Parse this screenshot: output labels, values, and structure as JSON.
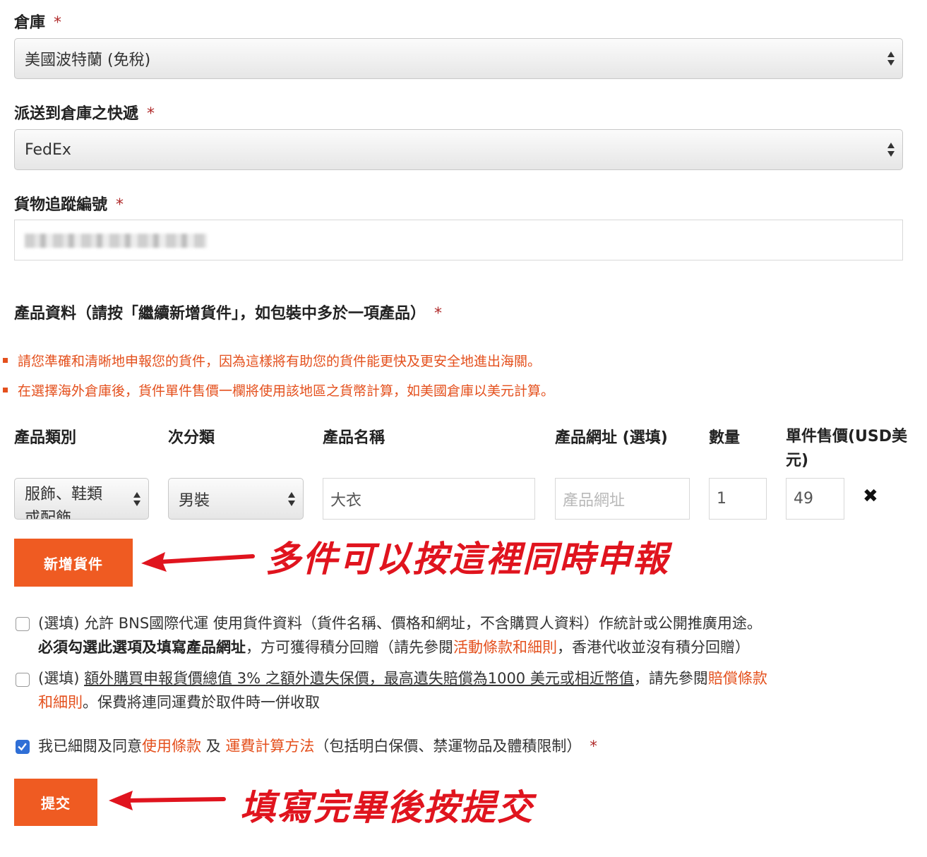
{
  "warehouse": {
    "label": "倉庫",
    "required": "*",
    "selected": "美國波特蘭 (免稅)"
  },
  "courier": {
    "label": "派送到倉庫之快遞",
    "required": "*",
    "selected": "FedEx"
  },
  "tracking": {
    "label": "貨物追蹤編號",
    "required": "*"
  },
  "products": {
    "label": "產品資料（請按「繼續新增貨件」，如包裝中多於一項產品）",
    "required": "*",
    "notices": [
      "請您準確和清晰地申報您的貨件，因為這樣將有助您的貨件能更快及更安全地進出海關。",
      "在選擇海外倉庫後，貨件單件售價一欄將使用該地區之貨幣計算，如美國倉庫以美元計算。"
    ],
    "columns": {
      "category": "產品類別",
      "subcategory": "次分類",
      "name": "產品名稱",
      "url": "產品網址 (選填)",
      "qty": "數量",
      "price_line1": "單件售價(USD美",
      "price_line2": "元)"
    },
    "row": {
      "category_line1": "服飾、鞋類",
      "category_line2": "或配飾",
      "subcategory": "男裝",
      "name": "大衣",
      "url_placeholder": "產品網址",
      "qty": "1",
      "price": "49",
      "remove": "✖"
    },
    "add_button": "新增貨件"
  },
  "annotations": {
    "add": "多件可以按這裡同時申報",
    "submit": "填寫完畢後按提交"
  },
  "option1": {
    "line1": "(選填) 允許 BNS國際代運 使用貨件資料（貨件名稱、價格和網址，不含購買人資料）作統計或公開推廣用途。",
    "bold": "必須勾選此選項及填寫產品網址",
    "mid": "，方可獲得積分回贈（請先參閱",
    "link": "活動條款和細則",
    "end": "，香港代收並沒有積分回贈）"
  },
  "option2": {
    "prefix": "(選填) ",
    "underlined": "額外購買申報貨價總值 3% 之額外遺失保價，最高遺失賠償為1000 美元或相近幣值",
    "mid": "，請先參閱",
    "link_line1": "賠償條款",
    "link_line2": "和細則",
    "end": "。保費將連同運費於取件時一併收取"
  },
  "agree": {
    "prefix": "我已細閱及同意",
    "link1": "使用條款",
    "and": " 及 ",
    "link2": "運費計算方法",
    "suffix": "（包括明白保價、禁運物品及體積限制）",
    "required": "*"
  },
  "submit_button": "提交"
}
